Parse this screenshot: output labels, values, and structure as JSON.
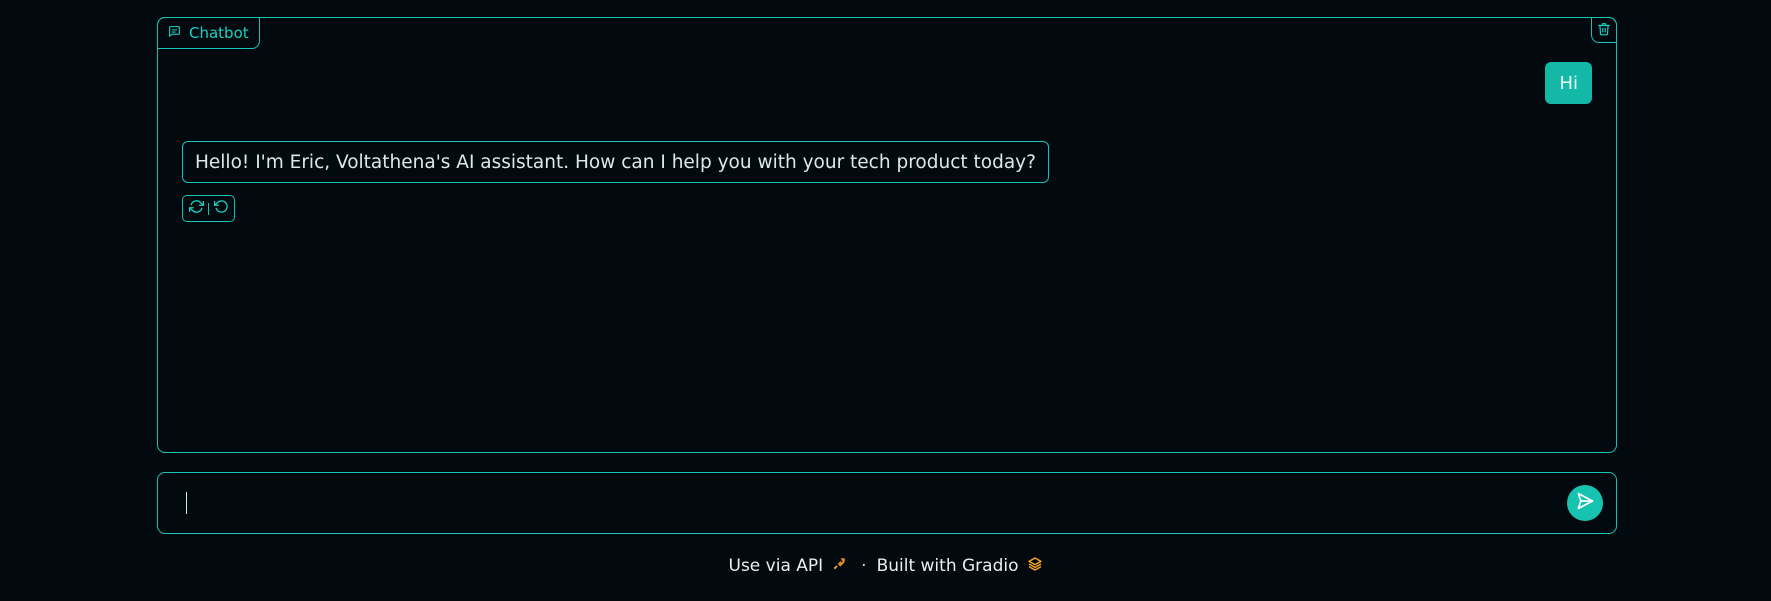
{
  "chatbot": {
    "label": "Chatbot",
    "label_icon": "chat-bubble-icon",
    "clear_icon": "trash-icon",
    "messages": [
      {
        "role": "user",
        "text": "Hi"
      },
      {
        "role": "assistant",
        "text": "Hello! I'm Eric, Voltathena's AI assistant. How can I help you with your tech product today?"
      }
    ],
    "message_actions": [
      {
        "icon": "retry-icon"
      },
      {
        "icon": "undo-icon"
      }
    ]
  },
  "input": {
    "value": "",
    "placeholder": "",
    "send_icon": "send-icon"
  },
  "footer": {
    "api_label": "Use via API",
    "api_icon": "rocket-icon",
    "separator": "·",
    "built_label": "Built with Gradio",
    "built_icon": "gradio-logo-icon"
  },
  "colors": {
    "background": "#020a10",
    "accent": "#14c4b3",
    "user_bubble": "#14b8a6",
    "text": "#dce8ea"
  }
}
